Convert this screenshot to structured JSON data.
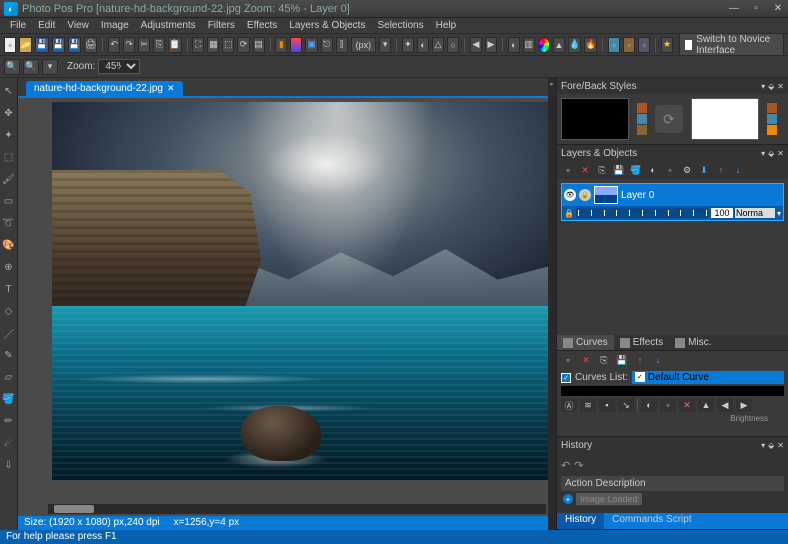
{
  "app": {
    "name": "Photo Pos Pro",
    "title": "Photo Pos Pro [nature-hd-background-22.jpg Zoom: 45% - Layer 0]"
  },
  "menubar": [
    "File",
    "Edit",
    "View",
    "Image",
    "Adjustments",
    "Filters",
    "Effects",
    "Layers & Objects",
    "Selections",
    "Help"
  ],
  "toolbar": {
    "zoom_label": "Zoom:",
    "zoom_value": "45%",
    "px_label": "(px)",
    "novice_label": "Switch to Novice Interface"
  },
  "document": {
    "tab_name": "nature-hd-background-22.jpg"
  },
  "status": {
    "size": "Size: (1920 x 1080) px,240 dpi",
    "coords": "x=1256,y=4 px"
  },
  "panels": {
    "foreback": {
      "title": "Fore/Back Styles"
    },
    "layers": {
      "title": "Layers & Objects",
      "layer_name": "Layer 0",
      "opacity_value": "100",
      "blend_mode": "Norma",
      "subtabs": {
        "curves": "Curves",
        "effects": "Effects",
        "misc": "Misc."
      },
      "curves_list_label": "Curves List:",
      "curves_selected": "Default Curve",
      "fx_brightness_label": "Brightness"
    },
    "history": {
      "title": "History",
      "action_header": "Action Description",
      "action_item": "Image Loaded",
      "tabs": {
        "history": "History",
        "commands": "Commands Script"
      }
    }
  },
  "footer": {
    "help": "For help please press F1"
  }
}
